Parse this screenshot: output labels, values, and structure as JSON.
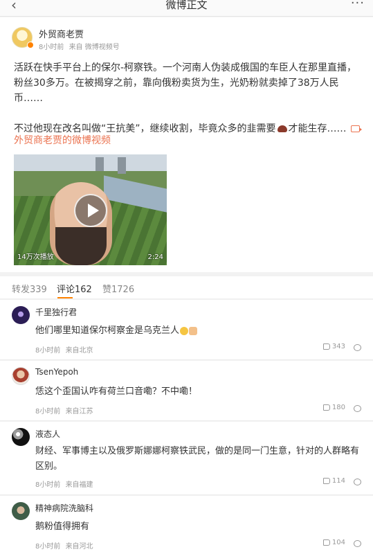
{
  "header": {
    "back_icon": "chevron-left-icon",
    "title": "微博正文",
    "more_label": "···"
  },
  "post": {
    "author": "外贸商老贾",
    "time": "8小时前",
    "source": "来自 微博视频号",
    "text1": "活跃在快手平台上的保尔-柯察铁。一个河南人伪装成俄国的车臣人在那里直播，粉丝30多万。在被揭穿之前，靠向俄粉卖货为生，光奶粉就卖掉了38万人民币……",
    "text2_prefix": "不过他现在改名叫做“王抗美”，继续收割，毕竟众多的韭需要",
    "text2_suffix": "才能生存……",
    "inline_emoji": "poop-icon",
    "video_link": "外贸商老贾的微博视频",
    "video": {
      "views": "14万次播放",
      "duration": "2:24"
    }
  },
  "tabs": [
    {
      "label": "转发339"
    },
    {
      "label": "评论162"
    },
    {
      "label": "赞1726"
    }
  ],
  "comments": [
    {
      "name": "千里独行君",
      "text": "他们哪里知道保尔柯察金是乌克兰人",
      "time": "8小时前",
      "source": "来自北京",
      "likes": "343"
    },
    {
      "name": "TsenYepoh",
      "text": "恁这个歪国认咋有荷兰口音嘞？不中嘞！",
      "time": "8小时前",
      "source": "来自江苏",
      "likes": "180"
    },
    {
      "name": "液态人",
      "text": "财经、军事博主以及俄罗斯娜娜柯察铁武民，做的是同一门生意，针对的人群略有区别。",
      "time": "8小时前",
      "source": "来自福建",
      "likes": "114"
    },
    {
      "name": "精神病院洗脑科",
      "text": "鹅粉值得拥有",
      "time": "8小时前",
      "source": "来自河北",
      "likes": "104"
    }
  ],
  "colors": {
    "link": "#eb7350",
    "accent": "#ff8200"
  }
}
